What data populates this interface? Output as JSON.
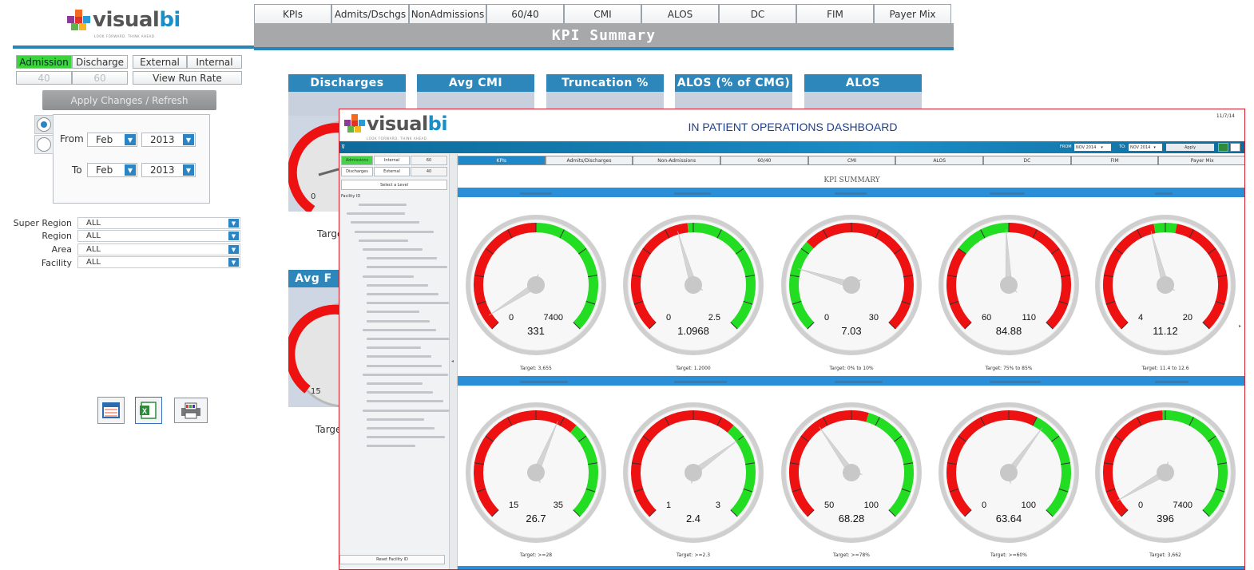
{
  "back": {
    "logo_text": "visual",
    "logo_bi": "bi",
    "logo_tagline": "LOOK FORWARD. THINK AHEAD.",
    "top_tabs": [
      "KPIs",
      "Admits/Dschgs",
      "NonAdmissions",
      "60/40",
      "CMI",
      "ALOS",
      "DC",
      "FIM",
      "Payer Mix"
    ],
    "title": "KPI Summary",
    "mode_options": [
      "Admission",
      "Discharge"
    ],
    "mode_selected": "Admission",
    "scope_options": [
      "External",
      "Internal"
    ],
    "split_options": [
      "40",
      "60"
    ],
    "view_run_rate": "View Run Rate",
    "apply_button": "Apply Changes / Refresh",
    "from_label": "From",
    "to_label": "To",
    "from_month": "Feb",
    "from_year": "2013",
    "to_month": "Feb",
    "to_year": "2013",
    "filters": [
      {
        "label": "Super Region",
        "value": "ALL"
      },
      {
        "label": "Region",
        "value": "ALL"
      },
      {
        "label": "Area",
        "value": "ALL"
      },
      {
        "label": "Facility",
        "value": "ALL"
      }
    ],
    "export_icons": [
      "calendar-icon",
      "excel-icon",
      "print-icon"
    ],
    "kpi_headers": [
      "Discharges",
      "Avg CMI",
      "Truncation %",
      "ALOS (% of CMG)",
      "ALOS"
    ],
    "second_header": "Avg F",
    "gauge_fragments": [
      "0",
      "15"
    ],
    "target_fragments": [
      "Targe",
      "Targe"
    ]
  },
  "front": {
    "logo_text": "visual",
    "logo_bi": "bi",
    "logo_tagline": "LOOK FORWARD. THINK AHEAD.",
    "title": "IN PATIENT OPERATIONS DASHBOARD",
    "date": "11/7/14",
    "from_label": "FROM",
    "from_value": "NOV 2014",
    "to_label": "TO:",
    "to_value": "NOV 2014",
    "apply": "Apply",
    "side_buttons": {
      "admissions": "Admissions",
      "internal": "Internal",
      "internal_val": "60",
      "discharges": "Discharges",
      "external": "External",
      "external_val": "40",
      "select_level": "Select a Level",
      "facility_id": "Facility ID",
      "reset": "Reset Facility ID"
    },
    "tabs": [
      "KPIs",
      "Admits/Discharges",
      "Non-Admissions",
      "60/40",
      "CMI",
      "ALOS",
      "DC",
      "FIM",
      "Payer Mix"
    ],
    "active_tab": "KPIs",
    "kpi_title": "KPI SUMMARY",
    "gauges_row1": [
      {
        "min": "0",
        "max": "7400",
        "value": "331",
        "target": "Target: 3,655"
      },
      {
        "min": "0",
        "max": "2.5",
        "value": "1.0968",
        "target": "Target: 1.2000"
      },
      {
        "min": "0",
        "max": "30",
        "value": "7.03",
        "target": "Target: 0% to 10%"
      },
      {
        "min": "60",
        "max": "110",
        "value": "84.88",
        "target": "Target: 75% to 85%"
      },
      {
        "min": "4",
        "max": "20",
        "value": "11.12",
        "target": "Target: 11.4 to 12.6"
      }
    ],
    "gauges_row2": [
      {
        "min": "15",
        "max": "35",
        "value": "26.7",
        "target": "Target: >=28"
      },
      {
        "min": "1",
        "max": "3",
        "value": "2.4",
        "target": "Target: >=2.3"
      },
      {
        "min": "50",
        "max": "100",
        "value": "68.28",
        "target": "Target: >=78%"
      },
      {
        "min": "0",
        "max": "100",
        "value": "63.64",
        "target": "Target: >=60%"
      },
      {
        "min": "0",
        "max": "7400",
        "value": "396",
        "target": "Target: 3,662"
      }
    ]
  },
  "colors": {
    "accent_blue": "#2a84b8",
    "gauge_red": "#ee1111",
    "gauge_green": "#22dd22",
    "selected_green": "#3bd43b"
  }
}
